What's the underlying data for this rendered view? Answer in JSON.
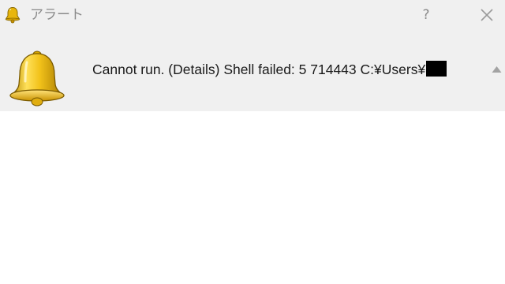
{
  "window": {
    "title": "アラート",
    "help_label": "?"
  },
  "message": {
    "text": "Cannot run. (Details) Shell failed: 5 714443 C:¥Users¥",
    "redacted": true
  },
  "icons": {
    "title_icon": "bell-icon",
    "message_icon": "bell-icon",
    "close_icon": "close-icon",
    "scroll_up_icon": "arrow-up-icon"
  },
  "colors": {
    "dialog_bg": "#f0f0f0",
    "bell_gold": "#e6b800"
  }
}
